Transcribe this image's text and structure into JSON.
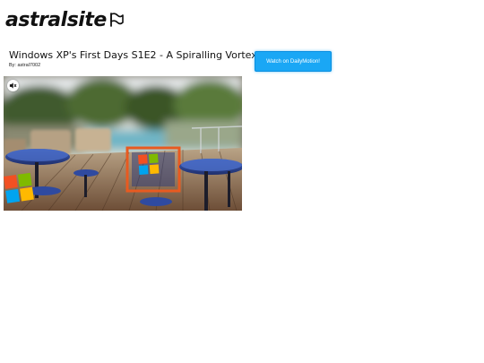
{
  "header": {
    "logo_text": "astralsite"
  },
  "video": {
    "title": "Windows XP's First Days S1E2 - A Spiralling Vortex",
    "author": "By: astral7002"
  },
  "actions": {
    "watch_label": "Watch on DailyMotion!"
  },
  "colors": {
    "accent": "#1aa7f5",
    "text": "#111111",
    "background": "#ffffff"
  },
  "icons": {
    "logo_mark": "flag-icon",
    "mute": "speaker-muted-icon"
  }
}
